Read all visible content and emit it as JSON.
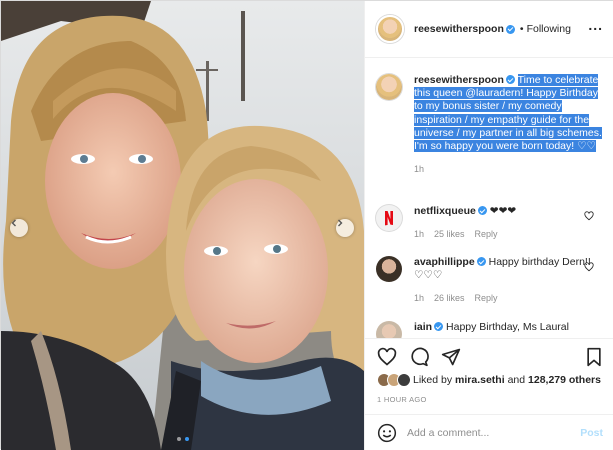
{
  "header": {
    "username": "reesewitherspoon",
    "separator": "•",
    "follow_label": "Following",
    "more_label": "..."
  },
  "caption": {
    "username": "reesewitherspoon",
    "text": "Time to celebrate this queen @lauradern! Happy Birthday to my bonus sister / my comedy inspiration / my empathy guide for the universe / my partner in all big schemes. I'm so happy you were born today! ♡♡",
    "time": "1h"
  },
  "comments": [
    {
      "username": "netflixqueue",
      "text": "❤❤❤",
      "time": "1h",
      "likes": "25 likes",
      "reply": "Reply",
      "avatar_color": "#f2f2f2"
    },
    {
      "username": "avaphillippe",
      "text": "Happy birthday Dern!! ♡♡♡",
      "time": "1h",
      "likes": "26 likes",
      "reply": "Reply",
      "avatar_color": "#3a3026"
    },
    {
      "username": "iain",
      "text": "Happy Birthday, Ms Laural",
      "time": "",
      "likes": "",
      "reply": "",
      "avatar_color": "#c9b9a6"
    }
  ],
  "likes": {
    "prefix": "Liked by",
    "user": "mira.sethi",
    "middle": "and",
    "count": "128,279 others"
  },
  "timestamp": "1 HOUR AGO",
  "add_comment": {
    "placeholder": "Add a comment...",
    "post_label": "Post"
  },
  "carousel": {
    "slides": 2,
    "active_index": 1
  },
  "colors": {
    "accent": "#3897f0",
    "highlight": "#3b84e0",
    "netflix_red": "#e50914"
  }
}
